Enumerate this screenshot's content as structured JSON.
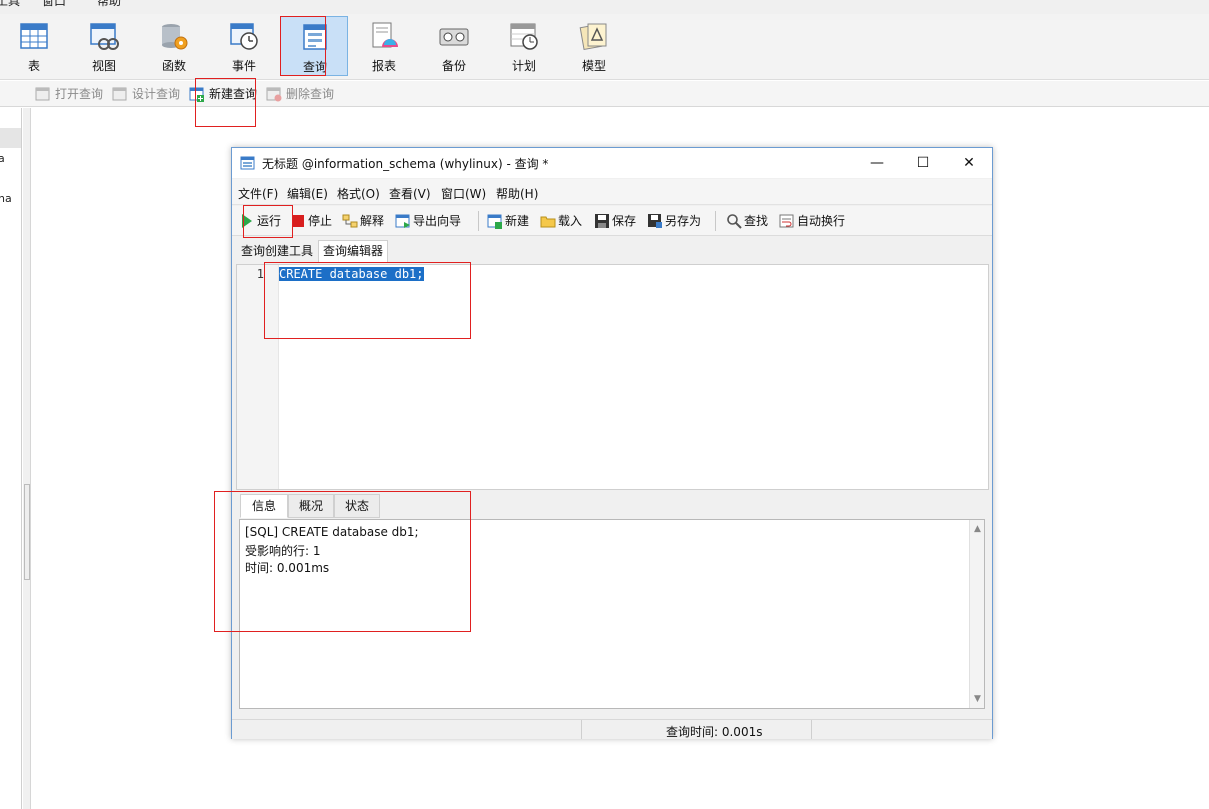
{
  "top_menu": {
    "items": [
      "工具",
      "窗口",
      "帮助"
    ]
  },
  "ribbon": {
    "buttons": [
      {
        "label": "表",
        "icon": "table-icon"
      },
      {
        "label": "视图",
        "icon": "view-icon"
      },
      {
        "label": "函数",
        "icon": "function-icon"
      },
      {
        "label": "事件",
        "icon": "event-icon"
      },
      {
        "label": "查询",
        "icon": "query-icon",
        "active": true
      },
      {
        "label": "报表",
        "icon": "report-icon"
      },
      {
        "label": "备份",
        "icon": "backup-icon"
      },
      {
        "label": "计划",
        "icon": "schedule-icon"
      },
      {
        "label": "模型",
        "icon": "model-icon"
      }
    ]
  },
  "subbar": {
    "open_query": "打开查询",
    "design_query": "设计查询",
    "new_query": "新建查询",
    "delete_query": "删除查询"
  },
  "left_pane": {
    "fragments": [
      "a",
      "na"
    ]
  },
  "query_window": {
    "title": "无标题 @information_schema (whylinux) - 查询 *",
    "controls": {
      "minimize": "—",
      "maximize": "☐",
      "close": "✕"
    },
    "menu": [
      "文件(F)",
      "编辑(E)",
      "格式(O)",
      "查看(V)",
      "窗口(W)",
      "帮助(H)"
    ],
    "toolbar": {
      "run": "运行",
      "stop": "停止",
      "explain": "解释",
      "export_wizard": "导出向导",
      "new": "新建",
      "load": "载入",
      "save": "保存",
      "save_as": "另存为",
      "find": "查找",
      "word_wrap": "自动换行"
    },
    "tabs": [
      "查询创建工具",
      "查询编辑器"
    ],
    "editor": {
      "line_number": "1",
      "code": "CREATE database db1;"
    },
    "result_tabs": [
      "信息",
      "概况",
      "状态"
    ],
    "result_lines": [
      "[SQL] CREATE database db1;",
      "受影响的行: 1",
      "时间: 0.001ms"
    ],
    "status": {
      "query_time": "查询时间: 0.001s"
    }
  },
  "colors": {
    "accent": "#1c6fc7",
    "annotation": "#e02020",
    "active_ribbon": "#c9e0f7"
  }
}
